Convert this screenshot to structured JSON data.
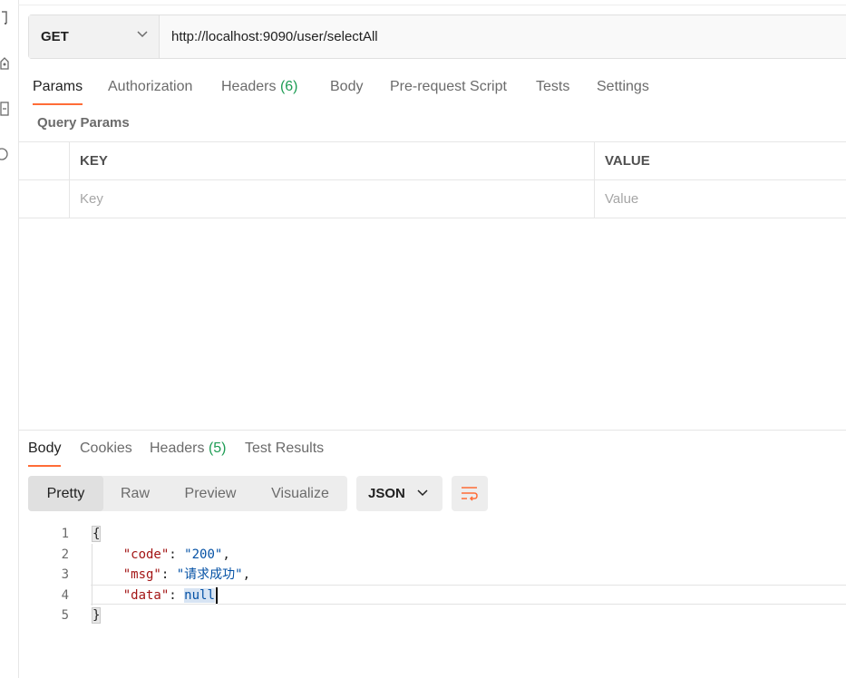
{
  "request": {
    "method": "GET",
    "url": "http://localhost:9090/user/selectAll"
  },
  "request_tabs": [
    {
      "label": "Params",
      "count": ""
    },
    {
      "label": "Authorization",
      "count": ""
    },
    {
      "label": "Headers",
      "count": "(6)"
    },
    {
      "label": "Body",
      "count": ""
    },
    {
      "label": "Pre-request Script",
      "count": ""
    },
    {
      "label": "Tests",
      "count": ""
    },
    {
      "label": "Settings",
      "count": ""
    }
  ],
  "query_params": {
    "title": "Query Params",
    "key_header": "KEY",
    "value_header": "VALUE",
    "key_placeholder": "Key",
    "value_placeholder": "Value"
  },
  "response_tabs": [
    {
      "label": "Body",
      "count": ""
    },
    {
      "label": "Cookies",
      "count": ""
    },
    {
      "label": "Headers",
      "count": "(5)"
    },
    {
      "label": "Test Results",
      "count": ""
    }
  ],
  "view_modes": [
    "Pretty",
    "Raw",
    "Preview",
    "Visualize"
  ],
  "format": "JSON",
  "response_body": {
    "line_numbers": [
      "1",
      "2",
      "3",
      "4",
      "5"
    ],
    "open_brace": "{",
    "close_brace": "}",
    "code_key": "\"code\"",
    "code_value": "\"200\"",
    "msg_key": "\"msg\"",
    "msg_value": "\"请求成功\"",
    "data_key": "\"data\"",
    "data_value": "null"
  },
  "colors": {
    "accent": "#ff6c37",
    "count_green": "#1f9d55",
    "json_key": "#a31515",
    "json_value": "#0451a5"
  }
}
